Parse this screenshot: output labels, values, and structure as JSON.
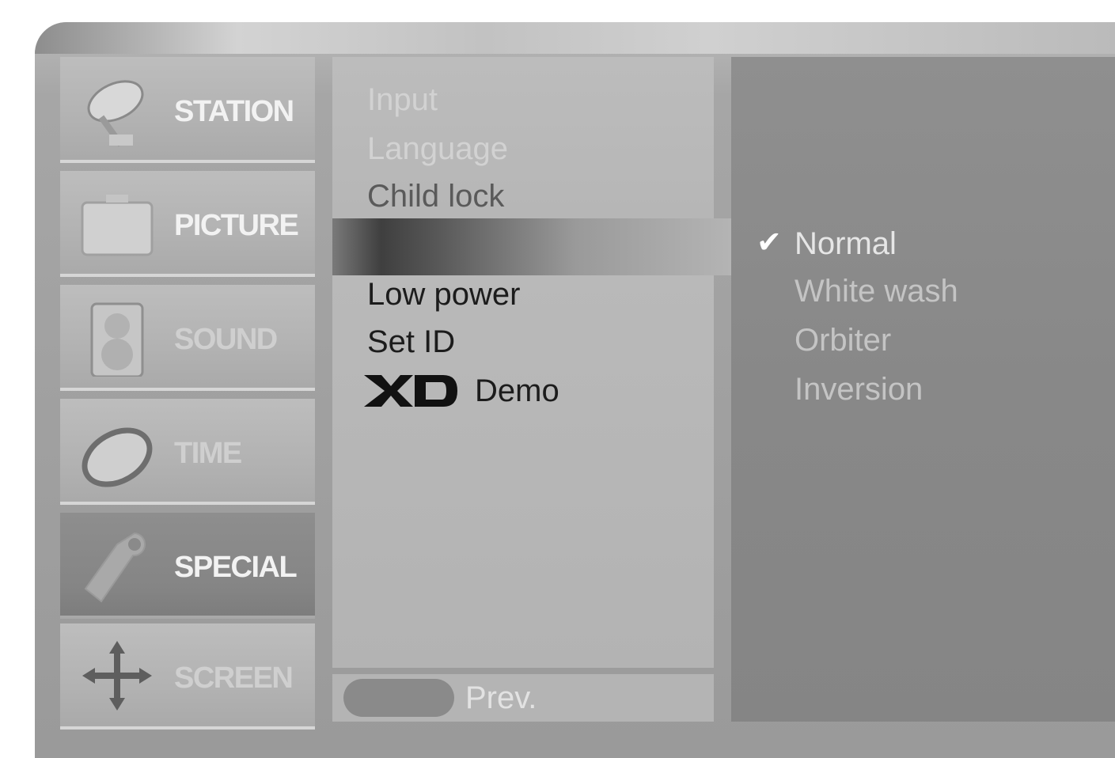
{
  "nav": {
    "items": [
      {
        "label": "STATION",
        "icon": "satellite-dish-icon"
      },
      {
        "label": "PICTURE",
        "icon": "picture-screen-icon"
      },
      {
        "label": "SOUND",
        "icon": "speaker-icon"
      },
      {
        "label": "TIME",
        "icon": "clock-ring-icon"
      },
      {
        "label": "SPECIAL",
        "icon": "tag-icon",
        "selected": true
      },
      {
        "label": "SCREEN",
        "icon": "move-arrows-icon"
      }
    ]
  },
  "menu": {
    "items": [
      "Input",
      "Language",
      "Child lock",
      "Low power",
      "Set ID"
    ],
    "xd_logo": "XD",
    "xd_demo_label": "Demo",
    "prev_label": "Prev."
  },
  "options": {
    "items": [
      "Normal",
      "White wash",
      "Orbiter",
      "Inversion"
    ],
    "selected": "Normal",
    "check_icon": "checkmark-icon"
  },
  "colors": {
    "frame": "#a6a6a6",
    "nav_selected": "#858585",
    "right_panel": "#888888",
    "highlight_dark": "#3f3f3f"
  }
}
